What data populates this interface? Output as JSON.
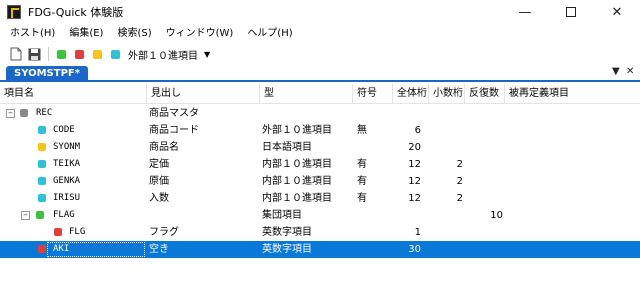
{
  "window": {
    "title": "FDG-Quick 体験版"
  },
  "menu": [
    "ホスト(H)",
    "編集(E)",
    "検索(S)",
    "ウィンドウ(W)",
    "ヘルプ(H)"
  ],
  "toolbar": {
    "type_label": "外部１０進項目"
  },
  "colors": {
    "green": "#3cc43c",
    "red": "#e43c3c",
    "yellow": "#f5c518",
    "cyan": "#2cc3d6",
    "gray": "#888888",
    "accent": "#0a78d7"
  },
  "tab": {
    "label": "SYOMSTPF*"
  },
  "columns": [
    "項目名",
    "見出し",
    "型",
    "符号",
    "全体桁",
    "小数桁",
    "反復数",
    "被再定義項目"
  ],
  "rows": [
    {
      "name": "REC",
      "heading": "商品マスタ",
      "type": "",
      "sign": "",
      "total": "",
      "decimal": "",
      "repeat": "",
      "dot": "gray"
    },
    {
      "name": "CODE",
      "heading": "商品コード",
      "type": "外部１０進項目",
      "sign": "無",
      "total": "6",
      "decimal": "",
      "repeat": "",
      "dot": "cyan"
    },
    {
      "name": "SYONM",
      "heading": "商品名",
      "type": "日本語項目",
      "sign": "",
      "total": "20",
      "decimal": "",
      "repeat": "",
      "dot": "yellow"
    },
    {
      "name": "TEIKA",
      "heading": "定価",
      "type": "内部１０進項目",
      "sign": "有",
      "total": "12",
      "decimal": "2",
      "repeat": "",
      "dot": "cyan"
    },
    {
      "name": "GENKA",
      "heading": "原価",
      "type": "内部１０進項目",
      "sign": "有",
      "total": "12",
      "decimal": "2",
      "repeat": "",
      "dot": "cyan"
    },
    {
      "name": "IRISU",
      "heading": "入数",
      "type": "内部１０進項目",
      "sign": "有",
      "total": "12",
      "decimal": "2",
      "repeat": "",
      "dot": "cyan"
    },
    {
      "name": "FLAG",
      "heading": "",
      "type": "集団項目",
      "sign": "",
      "total": "",
      "decimal": "",
      "repeat": "10",
      "dot": "green"
    },
    {
      "name": "FLG",
      "heading": "フラグ",
      "type": "英数字項目",
      "sign": "",
      "total": "1",
      "decimal": "",
      "repeat": "",
      "dot": "red"
    },
    {
      "name": "AKI",
      "heading": "空き",
      "type": "英数字項目",
      "sign": "",
      "total": "30",
      "decimal": "",
      "repeat": "",
      "dot": "red"
    }
  ]
}
